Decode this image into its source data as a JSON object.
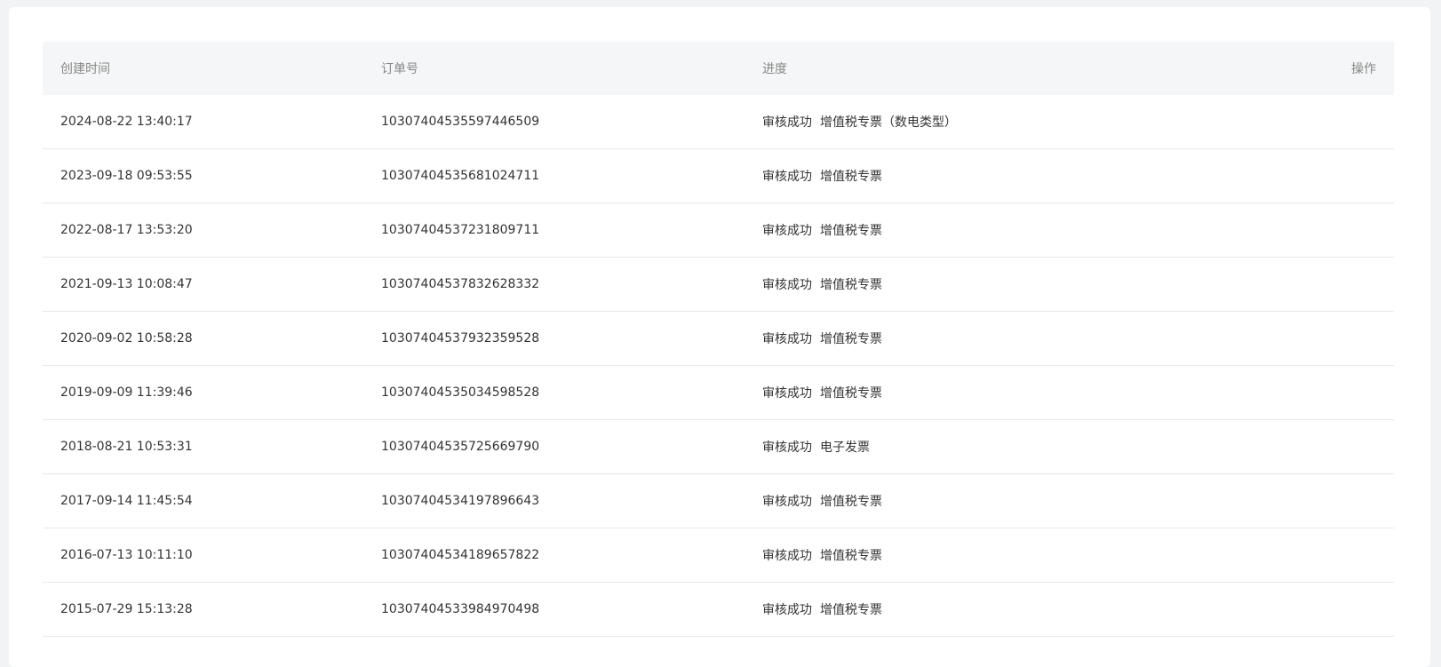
{
  "table": {
    "headers": {
      "created_time": "创建时间",
      "order_no": "订单号",
      "progress": "进度",
      "action": "操作"
    },
    "rows": [
      {
        "created_time": "2024-08-22 13:40:17",
        "order_no": "10307404535597446509",
        "status": "审核成功",
        "invoice_type": "增值税专票（数电类型）"
      },
      {
        "created_time": "2023-09-18 09:53:55",
        "order_no": "10307404535681024711",
        "status": "审核成功",
        "invoice_type": "增值税专票"
      },
      {
        "created_time": "2022-08-17 13:53:20",
        "order_no": "10307404537231809711",
        "status": "审核成功",
        "invoice_type": "增值税专票"
      },
      {
        "created_time": "2021-09-13 10:08:47",
        "order_no": "10307404537832628332",
        "status": "审核成功",
        "invoice_type": "增值税专票"
      },
      {
        "created_time": "2020-09-02 10:58:28",
        "order_no": "10307404537932359528",
        "status": "审核成功",
        "invoice_type": "增值税专票"
      },
      {
        "created_time": "2019-09-09 11:39:46",
        "order_no": "10307404535034598528",
        "status": "审核成功",
        "invoice_type": "增值税专票"
      },
      {
        "created_time": "2018-08-21 10:53:31",
        "order_no": "10307404535725669790",
        "status": "审核成功",
        "invoice_type": "电子发票"
      },
      {
        "created_time": "2017-09-14 11:45:54",
        "order_no": "10307404534197896643",
        "status": "审核成功",
        "invoice_type": "增值税专票"
      },
      {
        "created_time": "2016-07-13 10:11:10",
        "order_no": "10307404534189657822",
        "status": "审核成功",
        "invoice_type": "增值税专票"
      },
      {
        "created_time": "2015-07-29 15:13:28",
        "order_no": "10307404533984970498",
        "status": "审核成功",
        "invoice_type": "增值税专票"
      }
    ]
  }
}
